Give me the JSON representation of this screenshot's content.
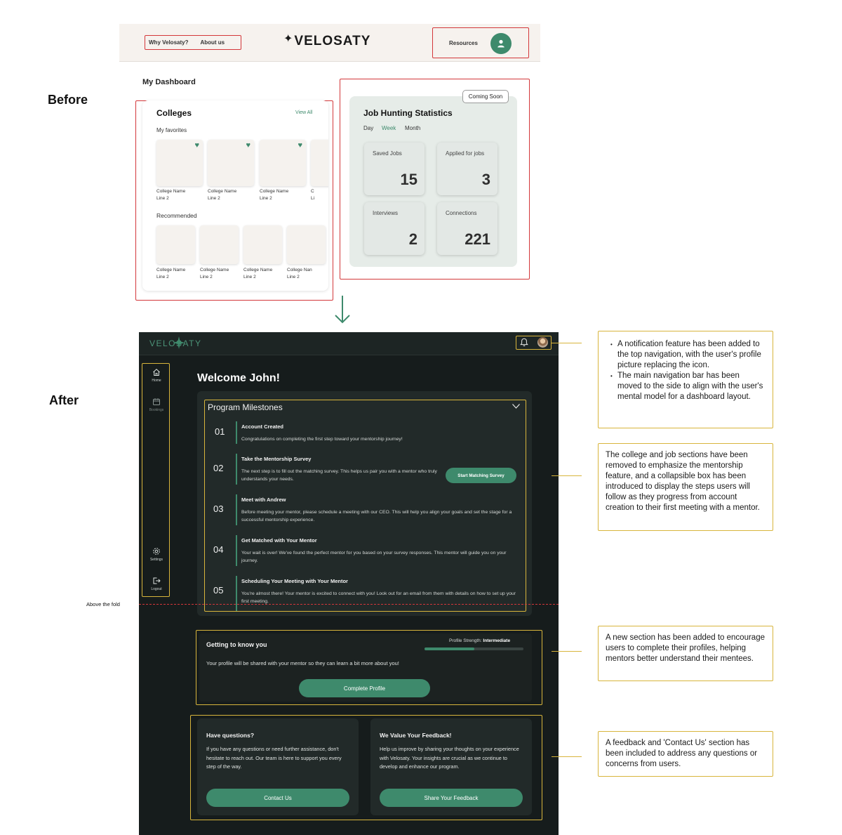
{
  "labels": {
    "before": "Before",
    "after": "After",
    "above_the_fold": "Above the fold"
  },
  "before": {
    "nav": {
      "why": "Why Velosaty?",
      "about": "About us",
      "logo": "VELOSATY",
      "resources": "Resources"
    },
    "dashboard_title": "My Dashboard",
    "colleges": {
      "title": "Colleges",
      "view_all": "View All",
      "favorites_label": "My favorites",
      "favorites": [
        {
          "name": "College Name",
          "line2": "Line 2"
        },
        {
          "name": "College Name",
          "line2": "Line 2"
        },
        {
          "name": "College Name",
          "line2": "Line 2"
        },
        {
          "name": "C",
          "line2": "Li"
        }
      ],
      "recommended_label": "Recommended",
      "recommended": [
        {
          "name": "College Name",
          "line2": "Line 2"
        },
        {
          "name": "College Name",
          "line2": "Line 2"
        },
        {
          "name": "College Name",
          "line2": "Line 2"
        },
        {
          "name": "College Nan",
          "line2": "Line 2"
        }
      ]
    },
    "jobs": {
      "badge": "Coming Soon",
      "title": "Job Hunting Statistics",
      "periods": [
        "Day",
        "Week",
        "Month"
      ],
      "active_period": "Week",
      "stats": [
        {
          "label": "Saved Jobs",
          "value": "15"
        },
        {
          "label": "Applied for jobs",
          "value": "3"
        },
        {
          "label": "Interviews",
          "value": "2"
        },
        {
          "label": "Connections",
          "value": "221"
        }
      ]
    }
  },
  "after": {
    "logo": "VELOSATY",
    "sidebar": {
      "home": "Home",
      "bookings": "Bookings",
      "settings": "Settings",
      "logout": "Logout"
    },
    "welcome": "Welcome John!",
    "milestones": {
      "title": "Program Milestones",
      "steps": [
        {
          "num": "01",
          "title": "Account Created",
          "desc": "Congratulations on completing the first step toward your mentorship journey!"
        },
        {
          "num": "02",
          "title": "Take the Mentorship Survey",
          "desc": "The next step is to fill out the matching survey. This helps us pair you with a mentor who truly understands your needs."
        },
        {
          "num": "03",
          "title": "Meet with Andrew",
          "desc": "Before meeting your mentor, please schedule a meeting with our CEO. This will help you align your goals and set the stage for a successful mentorship experience."
        },
        {
          "num": "04",
          "title": "Get Matched with Your Mentor",
          "desc": "Your wait is over! We've found the perfect mentor for you based on your survey responses. This mentor will guide you on your journey."
        },
        {
          "num": "05",
          "title": "Scheduling Your Meeting with Your Mentor",
          "desc": "You're almost there! Your mentor is excited to connect with you! Look out for an email from them with details on how to set up your first meeting."
        }
      ],
      "survey_button": "Start Matching Survey"
    },
    "profile": {
      "title": "Getting to know you",
      "strength_label": "Profile Strength:",
      "strength_value": "Intermediate",
      "strength_fraction": 0.5,
      "desc": "Your profile will be shared with your mentor so they can learn a bit more about you!",
      "button": "Complete Profile"
    },
    "questions": {
      "title": "Have questions?",
      "desc": "If you have any questions or need further assistance, don't hesitate to reach out. Our team is here to support you every step of the way.",
      "button": "Contact Us"
    },
    "feedback": {
      "title": "We Value Your Feedback!",
      "desc": "Help us improve by sharing your thoughts on your experience with Velosaty. Your insights are crucial as we continue to develop and enhance our program.",
      "button": "Share Your Feedback"
    }
  },
  "annotations": {
    "nav_points": [
      "A notification feature has been added to the top navigation, with the user's profile picture replacing the icon.",
      "The main navigation bar has been moved to the side to align with the user's mental model for a dashboard layout."
    ],
    "milestones": "The college and job sections have been removed to emphasize the mentorship feature, and a collapsible box has been introduced to display the steps users will follow as they progress from account creation to their first meeting with a mentor.",
    "profile": "A new section has been added to encourage users to complete their profiles, helping mentors better understand their mentees.",
    "feedback": "A feedback and 'Contact Us' section has been included to address any questions or concerns from users."
  },
  "colors": {
    "accent": "#3e8a6c",
    "annotation_border": "#d8b53c",
    "before_highlight": "#d3373a",
    "after_bg": "#161c1c"
  },
  "icons": [
    "star-icon",
    "user-icon",
    "heart-icon",
    "down-arrow-icon",
    "bell-icon",
    "home-icon",
    "calendar-icon",
    "gear-icon",
    "logout-icon",
    "chevron-down-icon"
  ]
}
